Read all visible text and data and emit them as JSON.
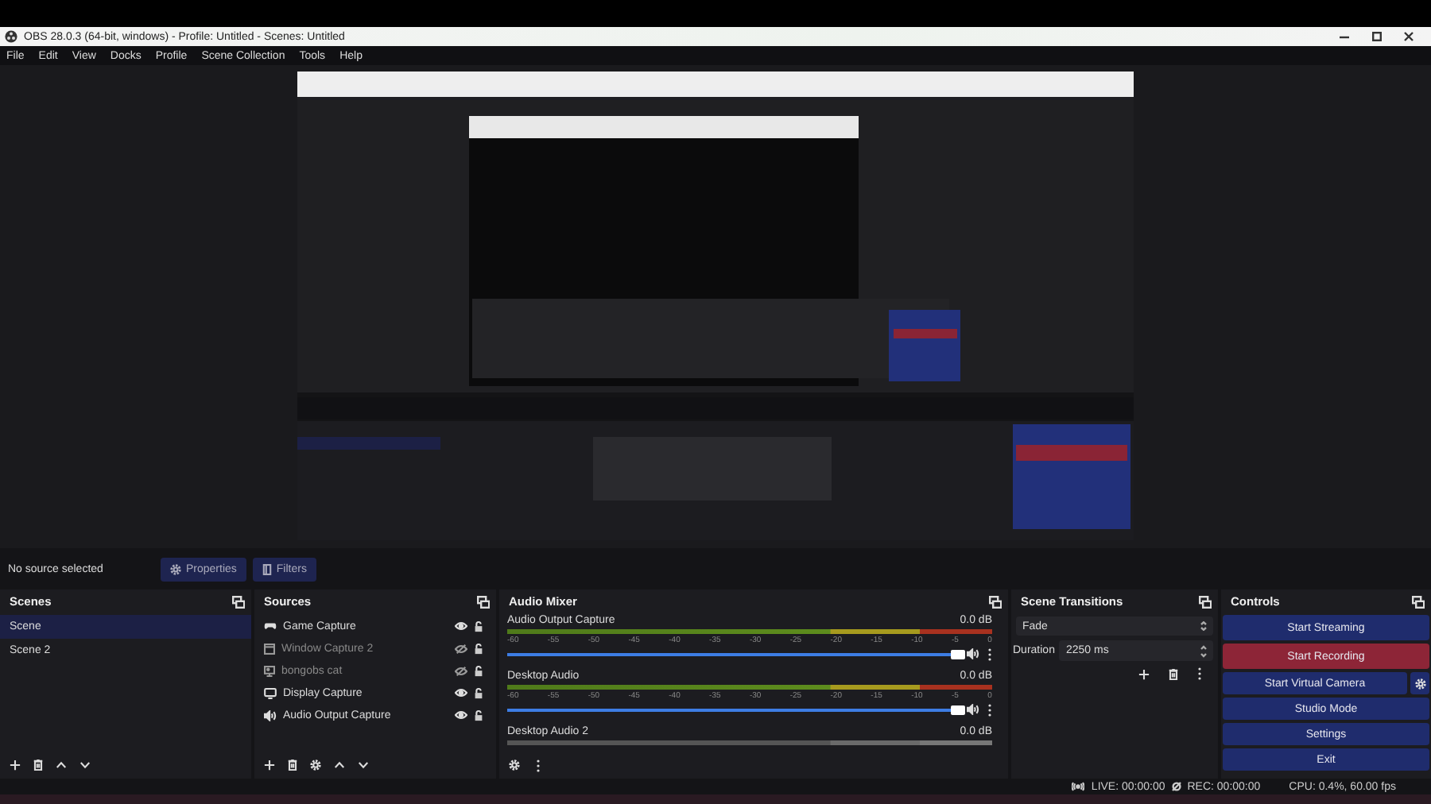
{
  "window": {
    "title": "OBS 28.0.3 (64-bit, windows) - Profile: Untitled - Scenes: Untitled"
  },
  "menu": [
    "File",
    "Edit",
    "View",
    "Docks",
    "Profile",
    "Scene Collection",
    "Tools",
    "Help"
  ],
  "source_bar": {
    "status": "No source selected",
    "buttons": [
      {
        "kind": "properties",
        "label": "Properties"
      },
      {
        "kind": "filters",
        "label": "Filters"
      }
    ]
  },
  "scenes": {
    "title": "Scenes",
    "items": [
      {
        "name": "Scene",
        "selected": true
      },
      {
        "name": "Scene 2",
        "selected": false
      }
    ]
  },
  "sources": {
    "title": "Sources",
    "items": [
      {
        "name": "Game Capture",
        "kind": "game",
        "visible": true
      },
      {
        "name": "Window Capture 2",
        "kind": "window",
        "visible": false
      },
      {
        "name": "bongobs cat",
        "visible": false
      },
      {
        "name": "Display Capture",
        "kind": "display",
        "visible": true
      },
      {
        "name": "Audio Output Capture",
        "kind": "audio",
        "visible": true
      }
    ]
  },
  "audio_mixer": {
    "title": "Audio Mixer",
    "channels": [
      {
        "name": "Audio Output Capture",
        "reading": "0.0 dB",
        "active": true,
        "level": 1,
        "scale": [
          "-60",
          "-55",
          "-50",
          "-45",
          "-40",
          "-35",
          "-30",
          "-25",
          "-20",
          "-15",
          "-10",
          "-5",
          "0"
        ]
      },
      {
        "name": "Desktop Audio",
        "reading": "0.0 dB",
        "active": true,
        "level": 1,
        "scale": [
          "-60",
          "-55",
          "-50",
          "-45",
          "-40",
          "-35",
          "-30",
          "-25",
          "-20",
          "-15",
          "-10",
          "-5",
          "0"
        ]
      },
      {
        "name": "Desktop Audio 2",
        "reading": "0.0 dB",
        "active": false
      }
    ]
  },
  "scene_transitions": {
    "title": "Scene Transitions",
    "transition": "Fade",
    "duration_label": "Duration",
    "duration": "2250 ms"
  },
  "controls": {
    "title": "Controls",
    "buttons": [
      {
        "label": "Start Streaming",
        "kind": "stream"
      },
      {
        "label": "Start Recording",
        "kind": "record"
      },
      {
        "label": "Start Virtual Camera",
        "kind": "virtualcam"
      },
      {
        "label": "Studio Mode",
        "kind": "plain"
      },
      {
        "label": "Settings",
        "kind": "plain"
      },
      {
        "label": "Exit",
        "kind": "plain"
      }
    ]
  },
  "status_bar": {
    "live": "LIVE: 00:00:00",
    "rec": "REC: 00:00:00",
    "cpu": "CPU: 0.4%, 60.00 fps"
  }
}
